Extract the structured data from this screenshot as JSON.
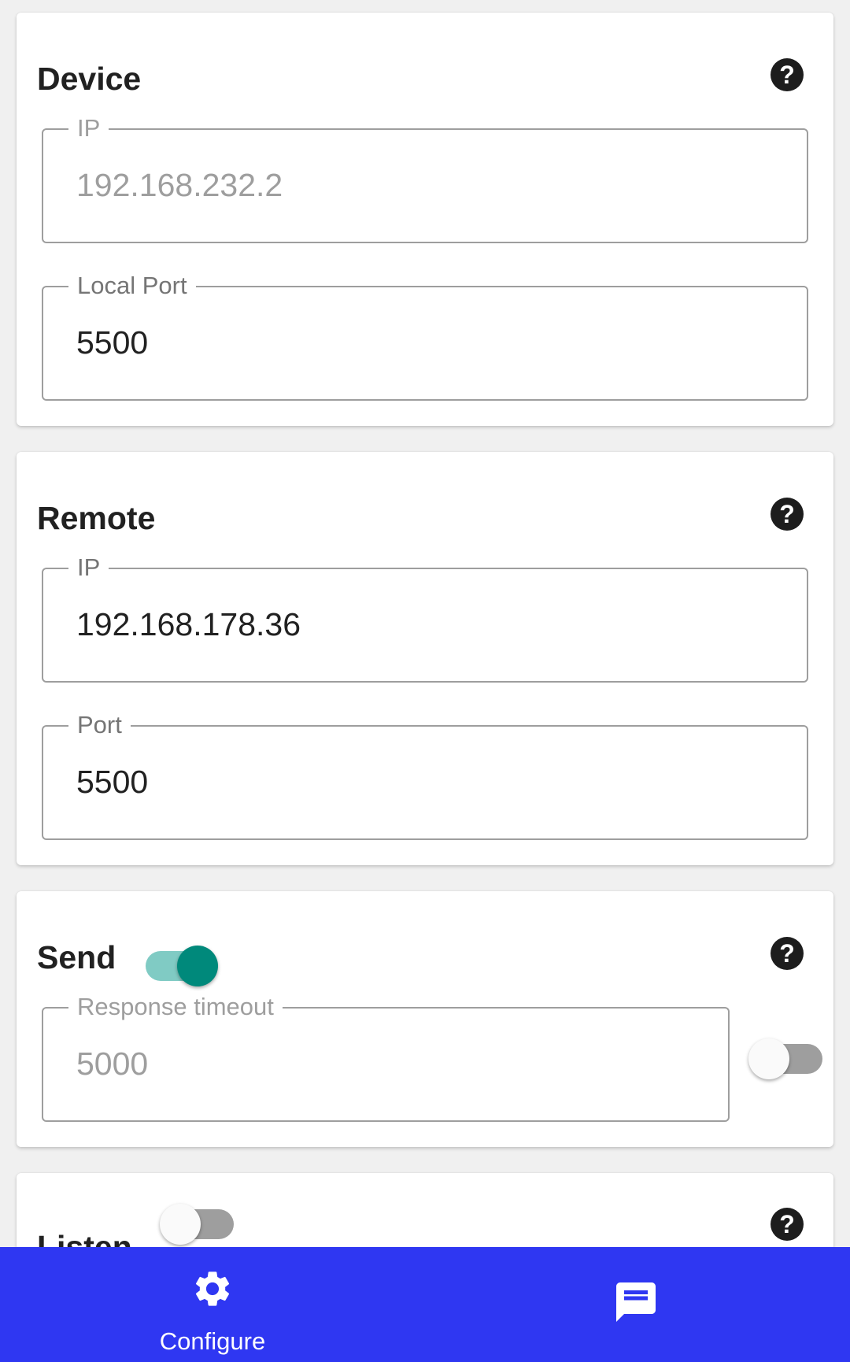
{
  "device": {
    "title": "Device",
    "ip_label": "IP",
    "ip_placeholder": "192.168.232.2",
    "local_port_label": "Local Port",
    "local_port_value": "5500"
  },
  "remote": {
    "title": "Remote",
    "ip_label": "IP",
    "ip_value": "192.168.178.36",
    "port_label": "Port",
    "port_value": "5500"
  },
  "send": {
    "title": "Send",
    "enabled": true,
    "response_timeout_label": "Response timeout",
    "response_timeout_placeholder": "5000",
    "response_timeout_enabled": false
  },
  "listen": {
    "title": "Listen",
    "enabled": false
  },
  "bottom_nav": {
    "items": [
      {
        "label": "Configure",
        "icon": "gear-icon",
        "selected": true
      },
      {
        "label": "",
        "icon": "message-icon",
        "selected": false
      }
    ]
  },
  "colors": {
    "accent": "#00897b",
    "accent_light": "#80cbc4",
    "nav_background": "#2f37f2",
    "help_icon": "#1d1d1d"
  }
}
